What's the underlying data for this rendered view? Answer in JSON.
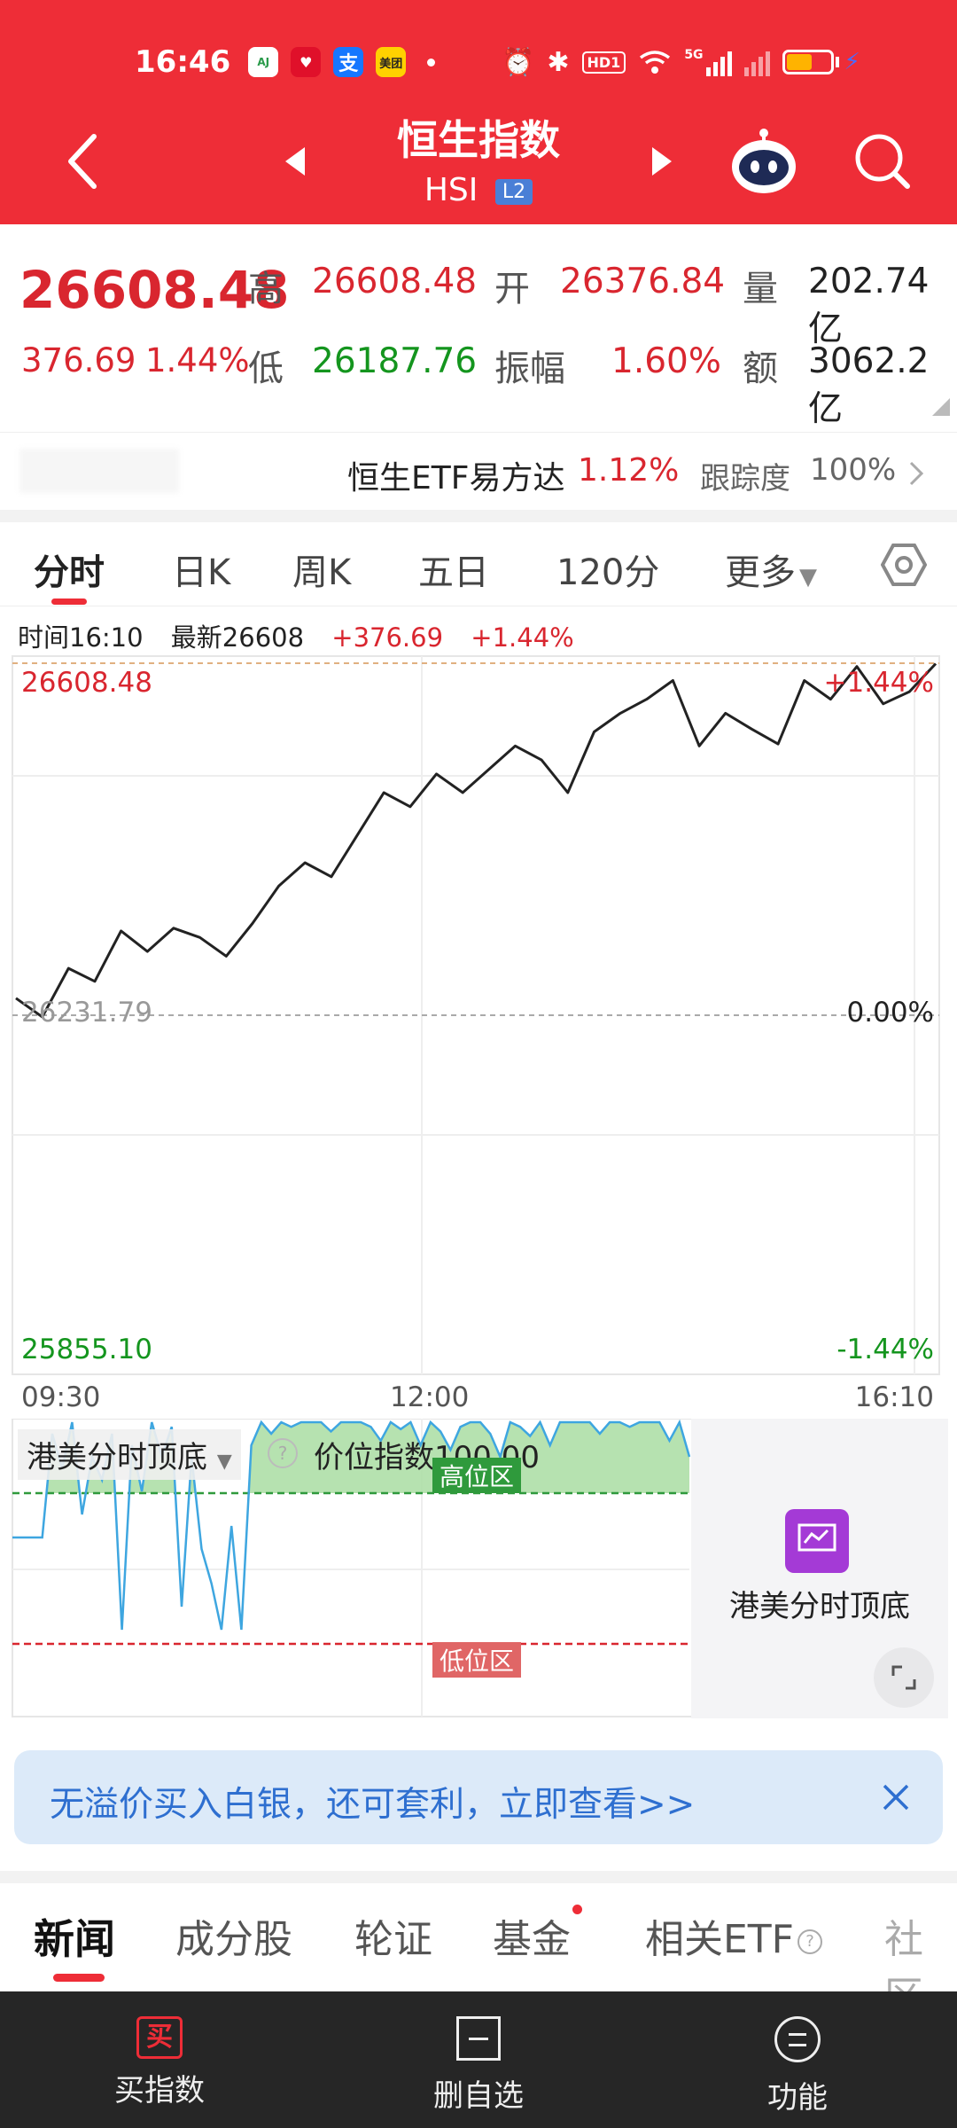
{
  "status_bar": {
    "time": "16:46",
    "app_icons": [
      "aj-app-icon",
      "red-app-icon",
      "alipay-icon",
      "meituan-icon"
    ],
    "meituan_label": "美团",
    "alipay_label": "支",
    "hd_label": "HD1",
    "net_label": "5G"
  },
  "header": {
    "title": "恒生指数",
    "code": "HSI",
    "level_badge": "L2"
  },
  "quote": {
    "price": "26608.48",
    "change": "376.69",
    "change_pct": "1.44%",
    "high_label": "高",
    "high": "26608.48",
    "low_label": "低",
    "low": "26187.76",
    "open_label": "开",
    "open": "26376.84",
    "amplitude_label": "振幅",
    "amplitude": "1.60%",
    "volume_label": "量",
    "volume": "202.74亿",
    "amount_label": "额",
    "amount": "3062.2亿"
  },
  "etf": {
    "name": "恒生ETF易方达",
    "pct": "1.12%",
    "tracking_label": "跟踪度",
    "tracking": "100%"
  },
  "tabs": {
    "items": [
      "分时",
      "日K",
      "周K",
      "五日",
      "120分",
      "更多"
    ]
  },
  "info": {
    "time_label": "时间16:10",
    "latest_label": "最新26608",
    "change": "+376.69",
    "change_pct": "+1.44%"
  },
  "chart_data": {
    "type": "line",
    "title": "",
    "x_ticks": [
      "09:30",
      "12:00",
      "16:10"
    ],
    "y_max_label": "26608.48",
    "y_prev_close_label": "26231.79",
    "y_min_label": "25855.10",
    "pct_top_label": "+1.44%",
    "pct_mid_label": "0.00%",
    "pct_bottom_label": "-1.44%",
    "ylim": [
      25855.1,
      26608.48
    ],
    "prev_close": 26231.79,
    "x": [
      "09:30",
      "09:40",
      "09:50",
      "10:00",
      "10:10",
      "10:20",
      "10:30",
      "10:40",
      "10:50",
      "11:00",
      "11:10",
      "11:20",
      "11:30",
      "11:40",
      "11:50",
      "12:00",
      "13:00",
      "13:10",
      "13:20",
      "13:30",
      "13:40",
      "13:50",
      "14:00",
      "14:10",
      "14:20",
      "14:30",
      "14:40",
      "14:50",
      "15:00",
      "15:10",
      "15:20",
      "15:30",
      "15:40",
      "15:50",
      "16:00",
      "16:10"
    ],
    "series": [
      {
        "values": [
          26250,
          26230,
          26282,
          26268,
          26322,
          26300,
          26325,
          26315,
          26295,
          26330,
          26370,
          26395,
          26380,
          26425,
          26470,
          26455,
          26490,
          26470,
          26495,
          26520,
          26505,
          26470,
          26535,
          26555,
          26570,
          26590,
          26520,
          26555,
          26538,
          26522,
          26590,
          26570,
          26605,
          26565,
          26578,
          26608
        ]
      }
    ]
  },
  "sub_chart": {
    "indicator_name": "港美分时顶底",
    "index_label": "价位指数100.00",
    "high_zone": "高位区",
    "low_zone": "低位区",
    "side_label": "港美分时顶底",
    "values": [
      50,
      50,
      50,
      50,
      95,
      80,
      100,
      60,
      85,
      75,
      95,
      10,
      90,
      70,
      100,
      85,
      98,
      20,
      85,
      45,
      30,
      10,
      55,
      10,
      90,
      100,
      95,
      100,
      98,
      100,
      100,
      100,
      96,
      100,
      100,
      100,
      98,
      92,
      100,
      97,
      100,
      90,
      100,
      96,
      88,
      98,
      100,
      100,
      95,
      85,
      100,
      98,
      94,
      100,
      90,
      100,
      100,
      100,
      100,
      95,
      100,
      100,
      98,
      100,
      100,
      100,
      92,
      100,
      85
    ]
  },
  "banner": {
    "text": "无溢价买入白银，还可套利，立即查看>>"
  },
  "news_tabs": {
    "items": [
      "新闻",
      "成分股",
      "轮证",
      "基金",
      "相关ETF",
      "社区"
    ]
  },
  "bottom_nav": {
    "buy": "买指数",
    "buy_icon": "买",
    "remove": "删自选",
    "func": "功能"
  },
  "colors": {
    "header_red": "#ee2d37",
    "up_red": "#d9262f",
    "down_green": "#14951e",
    "line_blue": "#3ea6e0",
    "banner_bg": "#dceaf9"
  }
}
